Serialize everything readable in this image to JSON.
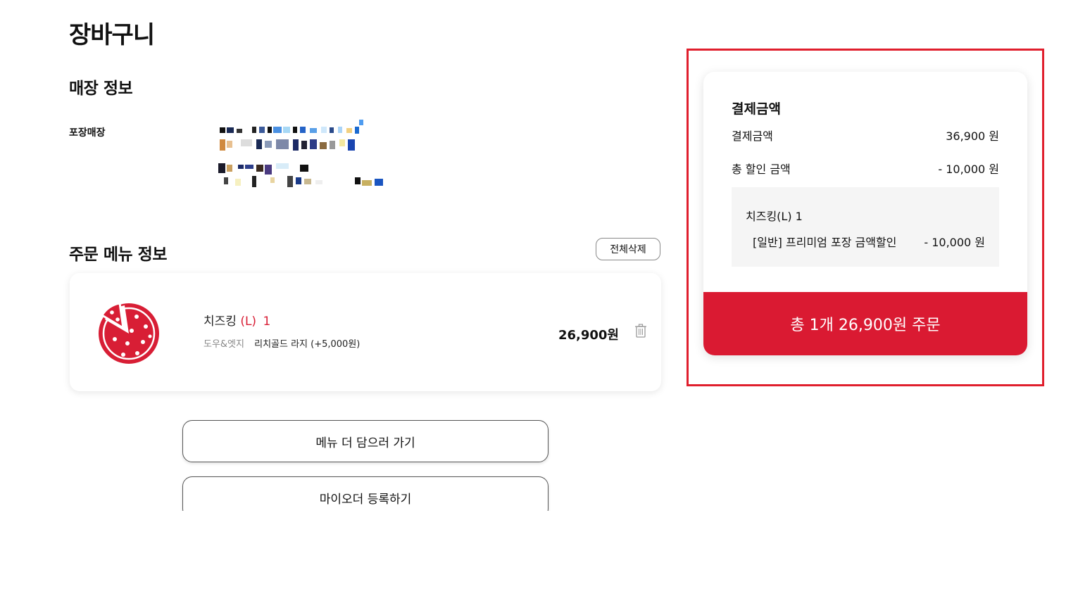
{
  "page": {
    "title": "장바구니"
  },
  "store": {
    "section_title": "매장 정보",
    "label": "포장매장"
  },
  "order": {
    "section_title": "주문 메뉴 정보",
    "clear_all_label": "전체삭제",
    "items": [
      {
        "name": "치즈킹",
        "size": "(L)",
        "quantity": "1",
        "option_key": "도우&엣지",
        "option_value": "리치골드 라지 (+5,000원)",
        "price": "26,900원"
      }
    ],
    "add_more_label": "메뉴 더 담으러 가기",
    "my_order_label": "마이오더 등록하기"
  },
  "summary": {
    "title": "결제금액",
    "payment_label": "결제금액",
    "payment_value": "36,900 원",
    "discount_label": "총 할인 금액",
    "discount_value": "- 10,000 원",
    "detail_item": "치즈킹(L) 1",
    "detail_discount_label": "[일반] 프리미엄 포장 금액할인",
    "detail_discount_value": "- 10,000 원",
    "order_button_label": "총 1개 26,900원 주문"
  },
  "colors": {
    "accent": "#da1a32",
    "highlight_border": "#e01f2d"
  },
  "icons": {
    "item_image": "pizza-icon",
    "delete": "trash-icon"
  }
}
